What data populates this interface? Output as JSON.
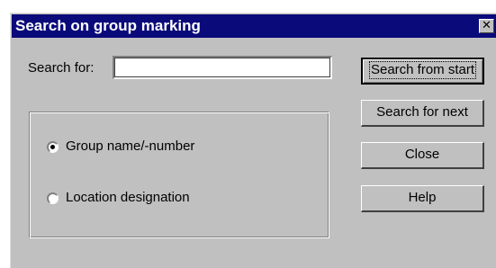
{
  "dialog": {
    "title": "Search on group marking",
    "close_glyph": "✕"
  },
  "search": {
    "label": "Search for:",
    "value": ""
  },
  "options": {
    "items": [
      {
        "label": "Group name/-number",
        "selected": true
      },
      {
        "label": "Location designation",
        "selected": false
      }
    ]
  },
  "buttons": {
    "search_from_start": "Search from start",
    "search_for_next": "Search for next",
    "close": "Close",
    "help": "Help"
  },
  "icons": {
    "close": "close-icon",
    "radio": "radio-button"
  },
  "colors": {
    "titlebar": "#0a0a7a",
    "face": "#c0c0c0"
  }
}
